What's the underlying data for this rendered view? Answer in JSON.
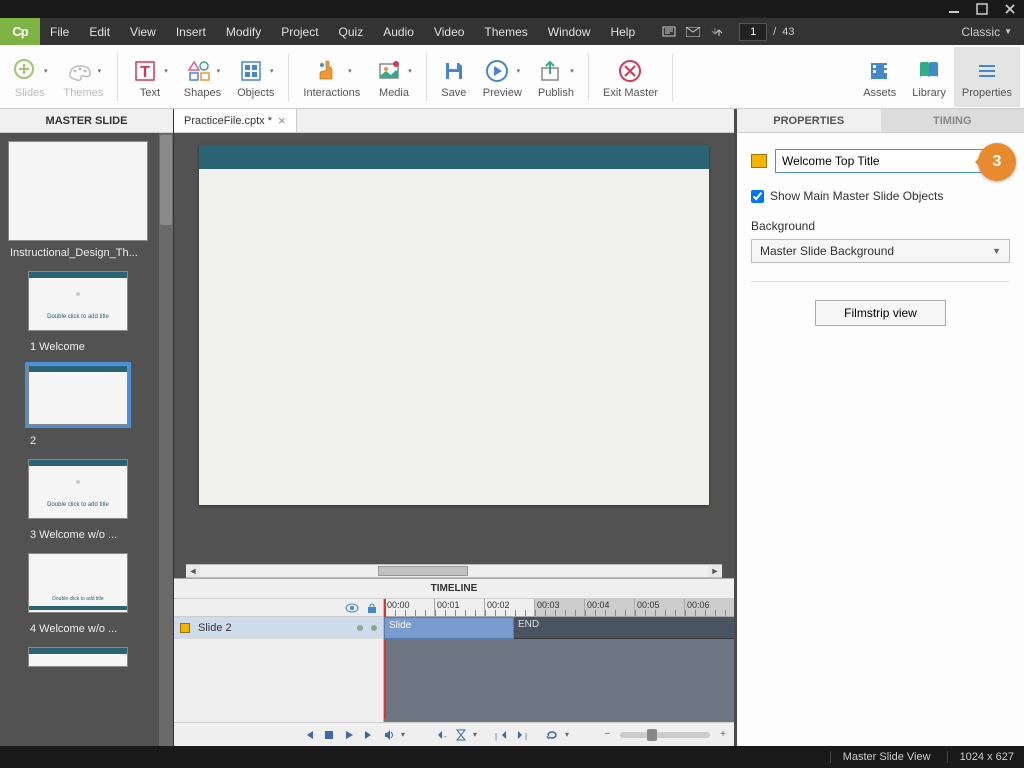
{
  "window": {
    "minimize": "_",
    "maximize": "□",
    "close": "×"
  },
  "menubar": {
    "logo": "Cp",
    "items": [
      "File",
      "Edit",
      "View",
      "Insert",
      "Modify",
      "Project",
      "Quiz",
      "Audio",
      "Video",
      "Themes",
      "Window",
      "Help"
    ],
    "slideCurrent": "1",
    "slideTotal": "43",
    "workspace": "Classic"
  },
  "ribbon": {
    "slides": "Slides",
    "themes": "Themes",
    "text": "Text",
    "shapes": "Shapes",
    "objects": "Objects",
    "interactions": "Interactions",
    "media": "Media",
    "save": "Save",
    "preview": "Preview",
    "publish": "Publish",
    "exitMaster": "Exit Master",
    "assets": "Assets",
    "library": "Library",
    "properties": "Properties"
  },
  "leftPanel": {
    "header": "MASTER SLIDE",
    "main": "Instructional_Design_Th...",
    "subs": [
      "1 Welcome",
      "2",
      "3 Welcome w/o ...",
      "4 Welcome w/o ..."
    ],
    "placeholderText": "Double click to add title"
  },
  "tabs": {
    "file": "PracticeFile.cptx *"
  },
  "timeline": {
    "header": "TIMELINE",
    "ticks": [
      "00:00",
      "00:01",
      "00:02",
      "00:03",
      "00:04",
      "00:05",
      "00:06"
    ],
    "trackName": "Slide 2",
    "clipLabel": "Slide",
    "endLabel": "END"
  },
  "rightPanel": {
    "tabProperties": "PROPERTIES",
    "tabTiming": "TIMING",
    "nameValue": "Welcome Top Title",
    "callout": "3",
    "showMainMaster": "Show Main Master Slide Objects",
    "backgroundLabel": "Background",
    "backgroundValue": "Master Slide Background",
    "filmstripBtn": "Filmstrip view"
  },
  "statusbar": {
    "view": "Master Slide View",
    "dims": "1024 x 627"
  }
}
